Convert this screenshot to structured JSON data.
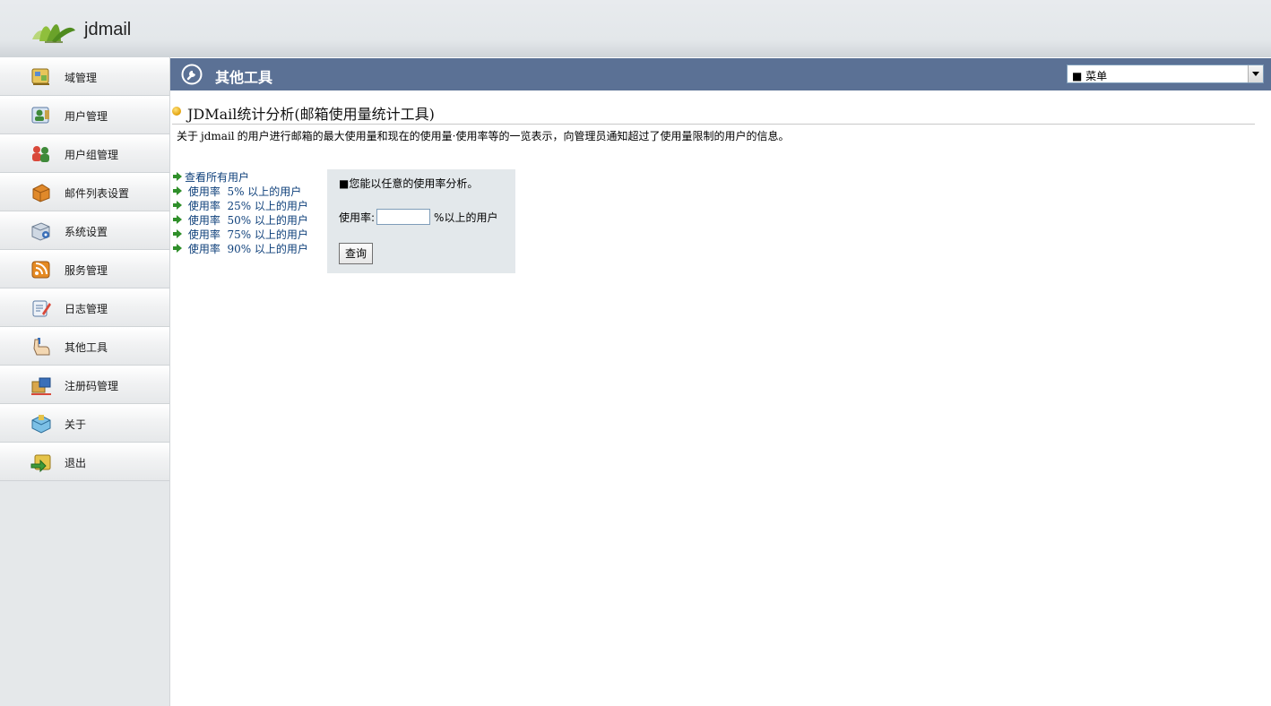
{
  "app": {
    "logo_text": "jdmail"
  },
  "sidebar": {
    "items": [
      {
        "label": "域管理",
        "icon": "domain-icon"
      },
      {
        "label": "用户管理",
        "icon": "user-icon"
      },
      {
        "label": "用户组管理",
        "icon": "user-group-icon"
      },
      {
        "label": "邮件列表设置",
        "icon": "mailing-list-icon"
      },
      {
        "label": "系统设置",
        "icon": "system-settings-icon"
      },
      {
        "label": "服务管理",
        "icon": "service-icon"
      },
      {
        "label": "日志管理",
        "icon": "log-icon"
      },
      {
        "label": "其他工具",
        "icon": "tools-icon"
      },
      {
        "label": "注册码管理",
        "icon": "registration-icon"
      },
      {
        "label": "关于",
        "icon": "about-icon"
      },
      {
        "label": "退出",
        "icon": "logout-icon"
      }
    ]
  },
  "header": {
    "title": "其他工具",
    "menu_select": "■ 菜单"
  },
  "main": {
    "section_title": "JDMail统计分析(邮箱使用量统计工具)",
    "description_prefix": "关于",
    "description_keyword": "jdmail",
    "description_suffix": "的用户进行邮箱的最大使用量和现在的使用量·使用率等的一览表示，向管理员通知超过了使用量限制的用户的信息。",
    "links": [
      "查看所有用户",
      " 使用率  5% 以上的用户",
      " 使用率  25% 以上的用户",
      " 使用率  50% 以上的用户",
      " 使用率  75% 以上的用户",
      " 使用率  90% 以上的用户"
    ],
    "panel": {
      "heading": "■您能以任意的使用率分析。",
      "rate_label": "使用率:",
      "rate_value": "",
      "rate_suffix": "%以上的用户",
      "query_button": "查询"
    }
  },
  "colors": {
    "titlebar": "#5b7195",
    "link": "#0d3f7a",
    "sidebar_bg": "#e5e8ea"
  }
}
